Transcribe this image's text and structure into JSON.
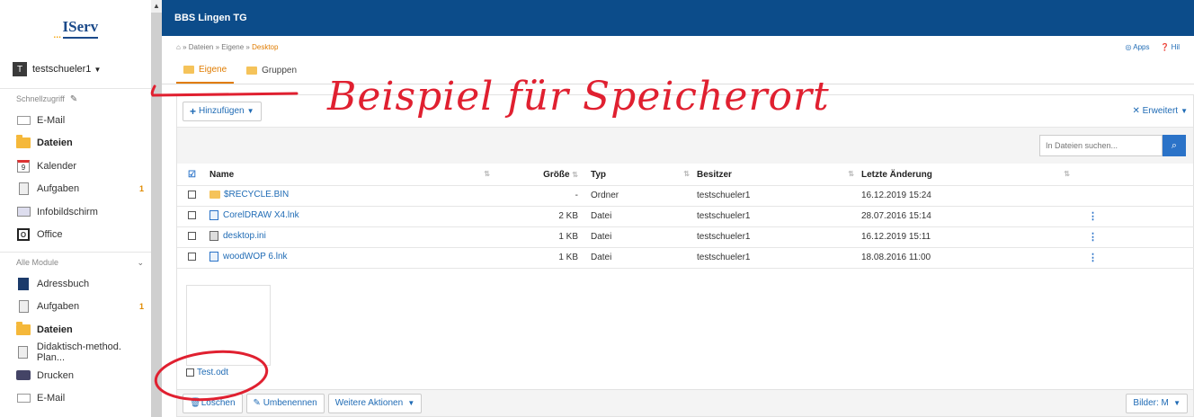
{
  "logo": {
    "dots": "...",
    "text": "IServ"
  },
  "user": {
    "initial": "T",
    "name": "testschueler1"
  },
  "quick": {
    "title": "Schnellzugriff"
  },
  "quick_items": [
    {
      "label": "E-Mail",
      "icon": "mail-icon",
      "badge": ""
    },
    {
      "label": "Dateien",
      "icon": "folder-icon",
      "badge": ""
    },
    {
      "label": "Kalender",
      "icon": "calendar-icon",
      "badge": ""
    },
    {
      "label": "Aufgaben",
      "icon": "task-icon",
      "badge": "1"
    },
    {
      "label": "Infobildschirm",
      "icon": "screen-icon",
      "badge": ""
    },
    {
      "label": "Office",
      "icon": "office-icon",
      "badge": ""
    }
  ],
  "modules": {
    "title": "Alle Module"
  },
  "module_items": [
    {
      "label": "Adressbuch",
      "badge": ""
    },
    {
      "label": "Aufgaben",
      "badge": "1"
    },
    {
      "label": "Dateien",
      "badge": ""
    },
    {
      "label": "Didaktisch-method. Plan...",
      "badge": ""
    },
    {
      "label": "Drucken",
      "badge": ""
    },
    {
      "label": "E-Mail",
      "badge": ""
    }
  ],
  "header": {
    "title": "BBS Lingen TG"
  },
  "breadcrumb": {
    "home": "⌂",
    "sep": "»",
    "items": [
      "Dateien",
      "Eigene"
    ],
    "current": "Desktop"
  },
  "top_links": {
    "apps": "◎ Apps",
    "help": "❓ Hil"
  },
  "tabs": [
    {
      "label": "Eigene"
    },
    {
      "label": "Gruppen"
    }
  ],
  "toolbar": {
    "add_label": "Hinzufügen",
    "advanced_label": "Erweitert"
  },
  "search": {
    "placeholder": "In Dateien suchen..."
  },
  "table": {
    "headers": {
      "name": "Name",
      "size": "Größe",
      "type": "Typ",
      "owner": "Besitzer",
      "date": "Letzte Änderung"
    },
    "rows": [
      {
        "name": "$RECYCLE.BIN",
        "size": "-",
        "type": "Ordner",
        "owner": "testschueler1",
        "date": "16.12.2019 15:24",
        "kind": "folder",
        "menu": ""
      },
      {
        "name": "CorelDRAW X4.lnk",
        "size": "2 KB",
        "type": "Datei",
        "owner": "testschueler1",
        "date": "28.07.2016 15:14",
        "kind": "file",
        "menu": "⋮"
      },
      {
        "name": "desktop.ini",
        "size": "1 KB",
        "type": "Datei",
        "owner": "testschueler1",
        "date": "16.12.2019 15:11",
        "kind": "ini",
        "menu": "⋮"
      },
      {
        "name": "woodWOP 6.lnk",
        "size": "1 KB",
        "type": "Datei",
        "owner": "testschueler1",
        "date": "18.08.2016 11:00",
        "kind": "file",
        "menu": "⋮"
      }
    ]
  },
  "thumbnail": {
    "name": "Test.odt"
  },
  "bottom": {
    "delete_label": "Löschen",
    "rename_label": "Umbenennen",
    "more_label": "Weitere Aktionen",
    "view_label": "Bilder: M"
  },
  "annotation": {
    "text": "Beispiel für Speicherort",
    "color": "#e02030"
  },
  "colors": {
    "header_bg": "#0c4c8a",
    "accent_orange": "#e07c00",
    "link_blue": "#1f6bb5"
  }
}
